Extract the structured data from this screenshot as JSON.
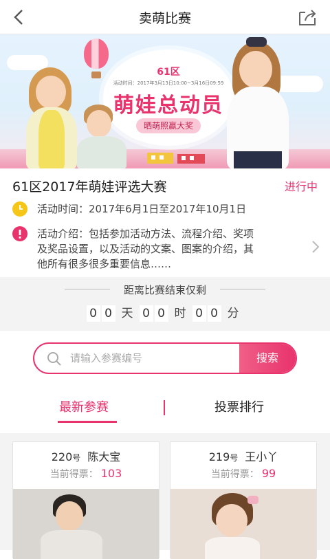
{
  "header": {
    "title": "卖萌比赛"
  },
  "banner": {
    "logo": "61区",
    "time": "活动时间：2017年3月13日10:00~3月16日09:59",
    "headline": "萌娃总动员",
    "pill": "晒萌照赢大奖"
  },
  "event": {
    "title": "61区2017年萌娃评选大赛",
    "status": "进行中",
    "time_line": "活动时间：2017年6月1日至2017年10月1日",
    "intro_line1": "活动介绍：包括参加活动方法、流程介绍、奖项",
    "intro_line2": "及奖品设置，以及活动的文案、图案的介绍，其",
    "intro_line3": "他所有很多很多重要信息……",
    "colors": {
      "accent": "#e8336d",
      "clock": "#f5c518"
    }
  },
  "countdown": {
    "title": "距离比赛结束仅剩",
    "days": [
      "0",
      "0"
    ],
    "days_unit": "天",
    "hours": [
      "0",
      "0"
    ],
    "hours_unit": "时",
    "minutes": [
      "0",
      "0"
    ],
    "minutes_unit": "分"
  },
  "search": {
    "placeholder": "请输入参赛编号",
    "button": "搜索"
  },
  "tabs": {
    "latest": "最新参赛",
    "ranking": "投票排行"
  },
  "entries": [
    {
      "number": "220",
      "hao": "号",
      "name": "陈大宝",
      "votes_label": "当前得票：",
      "votes": "103"
    },
    {
      "number": "219",
      "hao": "号",
      "name": "王小丫",
      "votes_label": "当前得票：",
      "votes": "99"
    }
  ]
}
